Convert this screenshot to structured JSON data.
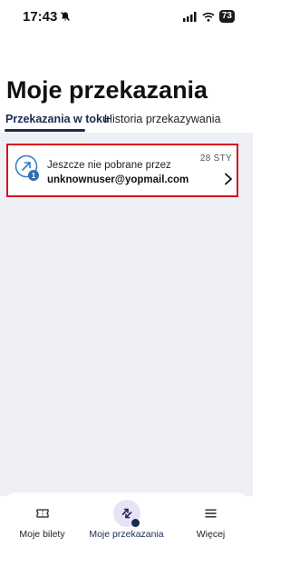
{
  "status_bar": {
    "time": "17:43",
    "battery": "73"
  },
  "page_title": "Moje przekazania",
  "tabs": [
    {
      "label": "Przekazania w toku",
      "active": true
    },
    {
      "label": "Historia przekazywania",
      "active": false
    }
  ],
  "transfers": [
    {
      "status": "Jeszcze nie pobrane przez",
      "email": "unknownuser@yopmail.com",
      "date": "28 STY",
      "badge_count": "1",
      "icon": "outgoing-arrow-icon"
    }
  ],
  "bottom_nav": [
    {
      "label": "Moje bilety",
      "icon": "ticket-icon",
      "active": false
    },
    {
      "label": "Moje przekazania",
      "icon": "transfer-arrows-icon",
      "active": true
    },
    {
      "label": "Więcej",
      "icon": "menu-icon",
      "active": false
    }
  ],
  "colors": {
    "brand_navy": "#1a2b52",
    "highlight_red": "#d6121f",
    "background": "#eef0f5",
    "icon_blue": "#2f7bbf"
  }
}
